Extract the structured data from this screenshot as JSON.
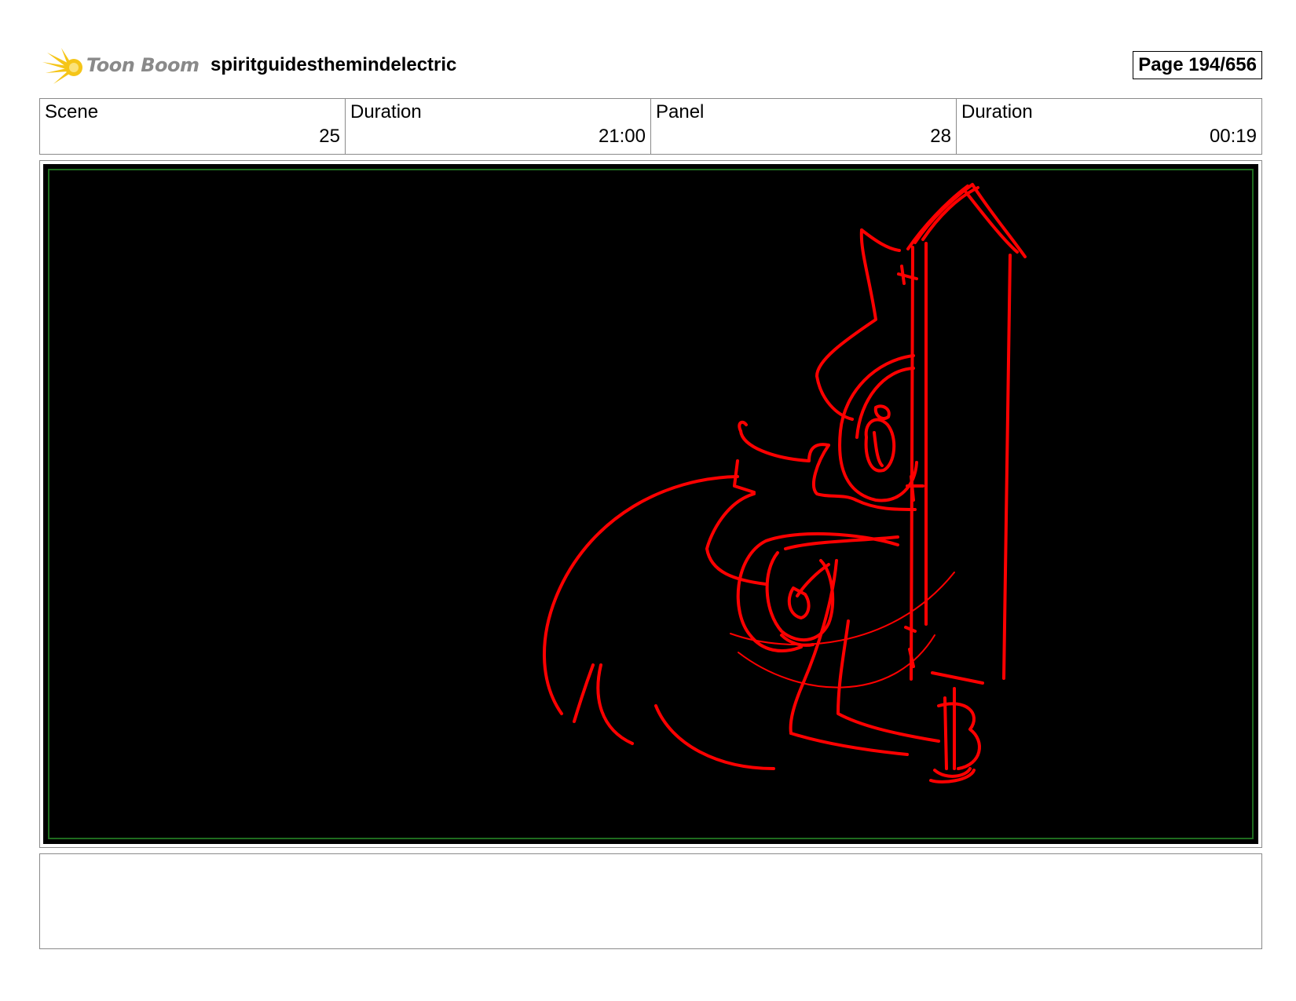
{
  "header": {
    "logo_text": "Toon Boom",
    "project_title": "spiritguidesthemindelectric",
    "page_label": "Page 194/656"
  },
  "info": {
    "scene_label": "Scene",
    "scene_value": "25",
    "scene_duration_label": "Duration",
    "scene_duration_value": "21:00",
    "panel_label": "Panel",
    "panel_value": "28",
    "panel_duration_label": "Duration",
    "panel_duration_value": "00:19"
  },
  "notes": {
    "text": ""
  },
  "colors": {
    "sketch": "#ff0000",
    "frame_background": "#000000",
    "safe_area": "#1e6b1e",
    "logo": "#f5c518"
  }
}
